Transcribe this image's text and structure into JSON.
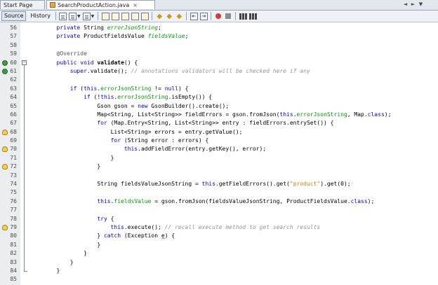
{
  "tabs": [
    {
      "label": "Start Page",
      "active": false
    },
    {
      "label": "SearchProductAction.java",
      "active": true,
      "close": "×"
    }
  ],
  "tab_nav": [
    "◄",
    "►",
    "▼"
  ],
  "toolbar": {
    "source_label": "Source",
    "history_label": "History",
    "icons": [
      "last-edit-icon",
      "back-icon",
      "forward-icon",
      "find-selection-icon",
      "find-previous-icon",
      "find-next-icon",
      "toggle-highlight-icon",
      "toggle-bookmark-icon",
      "previous-bookmark-icon",
      "next-bookmark-icon",
      "shift-left-icon",
      "shift-right-icon",
      "record-macro-icon",
      "stop-macro-icon",
      "comment-icon",
      "uncomment-icon"
    ]
  },
  "colors": {
    "keyword": "#0000e6",
    "field": "#009900",
    "comment": "#969696",
    "string": "#ce7b00"
  },
  "code_lines": [
    {
      "n": "56",
      "parts": [
        [
          "        ",
          ""
        ],
        [
          "private",
          "kw"
        ],
        [
          " String ",
          ""
        ],
        [
          "errorJsonString",
          "fld"
        ],
        [
          ";",
          ""
        ]
      ]
    },
    {
      "n": "57",
      "parts": [
        [
          "        ",
          ""
        ],
        [
          "private",
          "kw"
        ],
        [
          " ProductFieldsValue ",
          ""
        ],
        [
          "fieldsValue",
          "fld"
        ],
        [
          ";",
          ""
        ]
      ]
    },
    {
      "n": "58",
      "parts": []
    },
    {
      "n": "59",
      "parts": [
        [
          "        ",
          ""
        ],
        [
          "@Override",
          "ann"
        ]
      ]
    },
    {
      "n": "60",
      "parts": [
        [
          "        ",
          ""
        ],
        [
          "public",
          "kw"
        ],
        [
          " ",
          ""
        ],
        [
          "void",
          "kw"
        ],
        [
          " ",
          ""
        ],
        [
          "validate",
          "bold"
        ],
        [
          "() {",
          ""
        ]
      ]
    },
    {
      "n": "61",
      "parts": [
        [
          "            ",
          ""
        ],
        [
          "super",
          "kw"
        ],
        [
          ".validate(); ",
          ""
        ],
        [
          "// annotations validators will be checked here if any",
          "cm"
        ]
      ]
    },
    {
      "n": "62",
      "parts": []
    },
    {
      "n": "63",
      "parts": [
        [
          "            ",
          ""
        ],
        [
          "if",
          "kw"
        ],
        [
          " (",
          ""
        ],
        [
          "this",
          "kw"
        ],
        [
          ".",
          ""
        ],
        [
          "errorJsonString",
          "fld2"
        ],
        [
          " != ",
          ""
        ],
        [
          "null",
          "kw"
        ],
        [
          ") {",
          ""
        ]
      ]
    },
    {
      "n": "64",
      "parts": [
        [
          "                ",
          ""
        ],
        [
          "if",
          "kw"
        ],
        [
          " (!",
          ""
        ],
        [
          "this",
          "kw"
        ],
        [
          ".",
          ""
        ],
        [
          "errorJsonString",
          "fld2"
        ],
        [
          ".isEmpty()) {",
          ""
        ]
      ]
    },
    {
      "n": "65",
      "parts": [
        [
          "                    ",
          ""
        ],
        [
          "Gson gson = ",
          ""
        ],
        [
          "new",
          "kw"
        ],
        [
          " GsonBuilder().create();",
          ""
        ]
      ]
    },
    {
      "n": "66",
      "parts": [
        [
          "                    ",
          ""
        ],
        [
          "Map<String, List<String>> fieldErrors = gson.fromJson(",
          ""
        ],
        [
          "this",
          "kw"
        ],
        [
          ".",
          ""
        ],
        [
          "errorJsonString",
          "fld2"
        ],
        [
          ", Map.",
          ""
        ],
        [
          "class",
          "kw"
        ],
        [
          ");",
          ""
        ]
      ]
    },
    {
      "n": "67",
      "parts": [
        [
          "                    ",
          ""
        ],
        [
          "for",
          "kw"
        ],
        [
          " (Map.Entry<String, List<String>> entry : fieldErrors.entrySet()) {",
          ""
        ]
      ]
    },
    {
      "n": "68",
      "parts": [
        [
          "                        ",
          ""
        ],
        [
          "List<String> errors = entry.getValue();",
          ""
        ]
      ]
    },
    {
      "n": "69",
      "parts": [
        [
          "                        ",
          ""
        ],
        [
          "for",
          "kw"
        ],
        [
          " (String error : errors) {",
          ""
        ]
      ]
    },
    {
      "n": "70",
      "parts": [
        [
          "                            ",
          ""
        ],
        [
          "this",
          "kw"
        ],
        [
          ".addFieldError(entry.getKey(), error);",
          ""
        ]
      ]
    },
    {
      "n": "71",
      "parts": [
        [
          "                        ",
          ""
        ],
        [
          "}",
          ""
        ]
      ]
    },
    {
      "n": "72",
      "parts": [
        [
          "                    ",
          ""
        ],
        [
          "}",
          ""
        ]
      ]
    },
    {
      "n": "73",
      "parts": []
    },
    {
      "n": "74",
      "parts": [
        [
          "                    ",
          ""
        ],
        [
          "String fieldsValueJsonString = ",
          ""
        ],
        [
          "this",
          "kw"
        ],
        [
          ".getFieldErrors().get(",
          ""
        ],
        [
          "\"product\"",
          "str"
        ],
        [
          ").get(0);",
          ""
        ]
      ]
    },
    {
      "n": "75",
      "parts": []
    },
    {
      "n": "76",
      "parts": [
        [
          "                    ",
          ""
        ],
        [
          "this",
          "kw"
        ],
        [
          ".",
          ""
        ],
        [
          "fieldsValue",
          "fld2"
        ],
        [
          " = gson.fromJson(fieldsValueJsonString, ProductFieldsValue.",
          ""
        ],
        [
          "class",
          "kw"
        ],
        [
          ");",
          ""
        ]
      ]
    },
    {
      "n": "77",
      "parts": []
    },
    {
      "n": "78",
      "parts": [
        [
          "                    ",
          ""
        ],
        [
          "try",
          "kw"
        ],
        [
          " {",
          ""
        ]
      ]
    },
    {
      "n": "79",
      "parts": [
        [
          "                        ",
          ""
        ],
        [
          "this",
          "kw"
        ],
        [
          ".execute(); ",
          ""
        ],
        [
          "// recall execute method to get search results",
          "cm"
        ]
      ]
    },
    {
      "n": "80",
      "parts": [
        [
          "                    ",
          ""
        ],
        [
          "} ",
          ""
        ],
        [
          "catch",
          "kw"
        ],
        [
          " (Exception ",
          ""
        ],
        [
          "e",
          "par"
        ],
        [
          ") {",
          ""
        ]
      ]
    },
    {
      "n": "81",
      "parts": [
        [
          "                    ",
          ""
        ],
        [
          "}",
          ""
        ]
      ]
    },
    {
      "n": "82",
      "parts": [
        [
          "                ",
          ""
        ],
        [
          "}",
          ""
        ]
      ]
    },
    {
      "n": "83",
      "parts": [
        [
          "            ",
          ""
        ],
        [
          "}",
          ""
        ]
      ]
    },
    {
      "n": "84",
      "parts": [
        [
          "        ",
          ""
        ],
        [
          "}",
          ""
        ]
      ]
    },
    {
      "n": "85",
      "parts": []
    }
  ],
  "markers": {
    "60": "override",
    "61": "override",
    "68": "bulb",
    "70": "bulb",
    "72": "bulb",
    "79": "bulb"
  },
  "fold_toggle": "−"
}
